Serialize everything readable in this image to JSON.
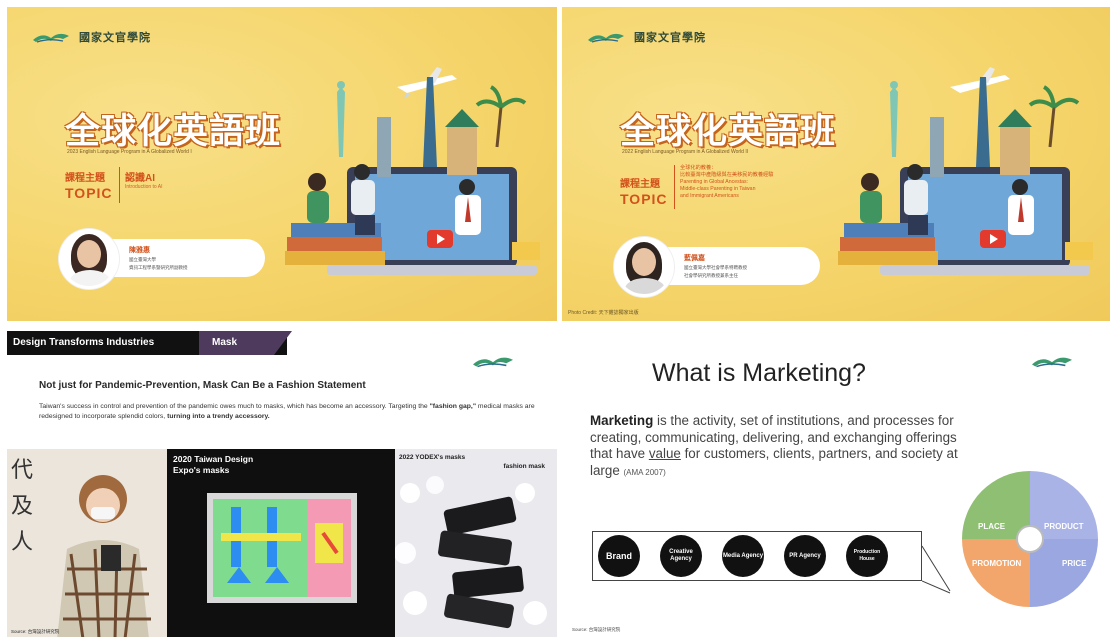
{
  "slide1": {
    "logo_text": "國家文官學院",
    "title": "全球化英語班",
    "subtitle": "2023 English Language Program in A Globalized World I",
    "topic_zh": "課程主題",
    "topic_en": "TOPIC",
    "topic_value": "認識AI",
    "topic_value_en": "Introduction to AI",
    "speaker_name": "陳雅惠",
    "speaker_line1": "國立臺灣大學",
    "speaker_line2": "資訊工程學系暨研究所副教授"
  },
  "slide2": {
    "logo_text": "國家文官學院",
    "title": "全球化英語班",
    "subtitle": "2022 English Language Program in A Globalized World II",
    "topic_zh": "課程主題",
    "topic_en": "TOPIC",
    "topic_lines": [
      "全球化的教養：",
      "比較臺灣中產階級與在美移民的教養經驗",
      "Parenting in Global Ancestas:",
      "Middle-class Parenting in Taiwan",
      "and Immigrant Americans"
    ],
    "speaker_name": "藍佩嘉",
    "speaker_line1": "國立臺灣大學社會學系特聘教授",
    "speaker_line2": "社會學研究所教授兼系主任",
    "credit": "Photo Credit: 天下雜誌獨家出版"
  },
  "slide3": {
    "banner_left": "Design Transforms Industries",
    "banner_tab": "Mask",
    "heading": "Not just for Pandemic-Prevention, Mask Can Be a Fashion Statement",
    "body_1": "Taiwan's success in control and prevention of the pandemic owes much to masks, which has become an accessory. Targeting the ",
    "body_bold1": "\"fashion gap,\"",
    "body_2": " medical masks are redesigned to incorporate splendid colors, ",
    "body_bold2": "turning into a trendy accessory.",
    "expo_label_1": "2020 Taiwan Design",
    "expo_label_2": "Expo's masks",
    "yodex_label": "2022 YODEX's masks",
    "fashion_label": "fashion mask",
    "source": "Source: 台灣設計研究院",
    "calligraphy": [
      "代",
      "及",
      "人"
    ]
  },
  "slide4": {
    "title": "What is Marketing?",
    "body_strong": "Marketing",
    "body_1": " is the activity, set of institutions, and processes for creating, communicating, delivering, and exchanging offerings that have ",
    "body_uline": "value",
    "body_2": " for customers, clients, partners, and society at large ",
    "body_small": "(AMA 2007)",
    "circles": [
      "Brand",
      "Creative Agency",
      "Media Agency",
      "PR Agency",
      "Production House"
    ],
    "quadrants": [
      "PLACE",
      "PRODUCT",
      "PROMOTION",
      "PRICE"
    ],
    "source": "Source: 台灣設計研究院"
  },
  "colors": {
    "slide_yellow": "#f5d56b",
    "accent_orange": "#d2521c",
    "banner_black": "#111111",
    "banner_purple": "#4d3a5d",
    "quad_place": "#8fbf72",
    "quad_product": "#a9b3e6",
    "quad_promotion": "#f2a66b",
    "quad_price": "#9aa7e0"
  }
}
